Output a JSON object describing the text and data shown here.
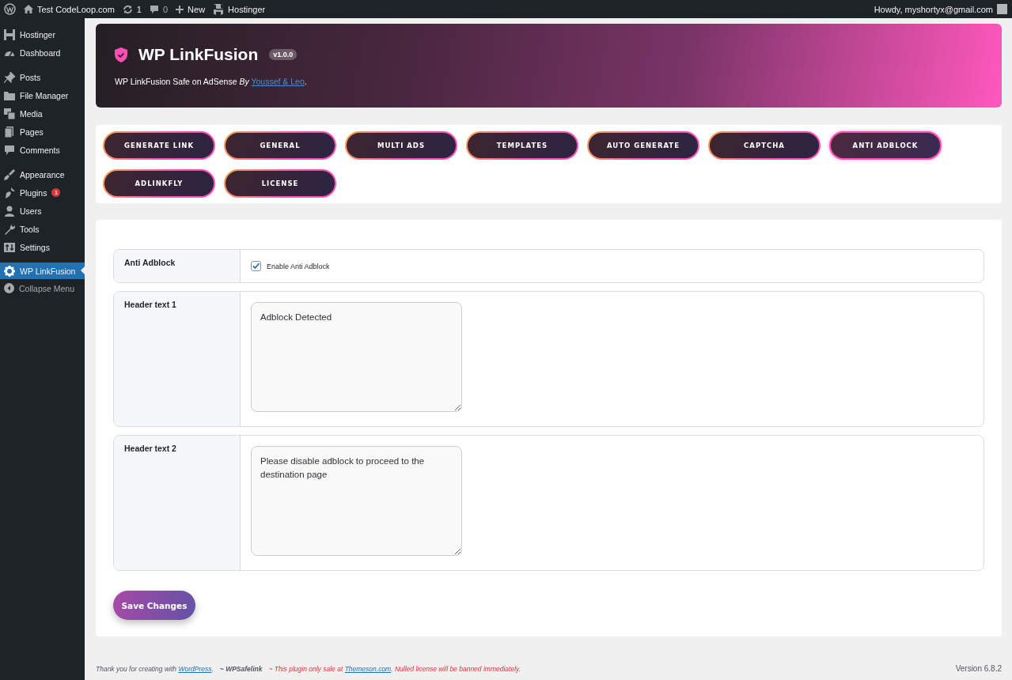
{
  "admin_bar": {
    "site": "Test CodeLoop.com",
    "updates": "1",
    "comments": "0",
    "new": "New",
    "hostinger": "Hostinger",
    "greeting": "Howdy, myshortyx@gmail.com"
  },
  "sidebar": {
    "groups": [
      [
        {
          "label": "Hostinger",
          "selected": false
        },
        {
          "label": "Dashboard",
          "selected": false
        }
      ],
      [
        {
          "label": "Posts",
          "selected": false
        },
        {
          "label": "File Manager",
          "selected": false
        },
        {
          "label": "Media",
          "selected": false
        },
        {
          "label": "Pages",
          "selected": false
        },
        {
          "label": "Comments",
          "selected": false
        }
      ],
      [
        {
          "label": "Appearance",
          "selected": false
        },
        {
          "label": "Plugins",
          "selected": false,
          "badge": "1"
        },
        {
          "label": "Users",
          "selected": false
        },
        {
          "label": "Tools",
          "selected": false
        },
        {
          "label": "Settings",
          "selected": false
        }
      ],
      [
        {
          "label": "WP LinkFusion",
          "selected": true
        }
      ]
    ],
    "collapse": "Collapse Menu"
  },
  "header": {
    "title": "WP LinkFusion",
    "version": "v1.0.0",
    "subtitle": "WP LinkFusion Safe on AdSense *By*",
    "author_link": "Youssef & Leo",
    "subtitle_end": "."
  },
  "nav_buttons": [
    {
      "label": "GENERATE LINK",
      "selected": false
    },
    {
      "label": "GENERAL",
      "selected": false
    },
    {
      "label": "MULTI ADS",
      "selected": false
    },
    {
      "label": "TEMPLATES",
      "selected": false
    },
    {
      "label": "AUTO GENERATE",
      "selected": false
    },
    {
      "label": "CAPTCHA",
      "selected": false
    },
    {
      "label": "ANTI ADBLOCK",
      "selected": true
    },
    {
      "label": "ADLINKFLY",
      "selected": false
    },
    {
      "label": "LICENSE",
      "selected": false
    }
  ],
  "fields": [
    {
      "kind": "checkbox",
      "label": "Anti Adblock",
      "option": "Enable Anti Adblock",
      "checked": true
    },
    {
      "kind": "textarea",
      "label": "Header text 1",
      "value": "Adblock Detected"
    },
    {
      "kind": "textarea",
      "label": "Header text 2",
      "value": "Please disable adblock to proceed to the destination page"
    }
  ],
  "save_button": "Save Changes",
  "footer": {
    "thanks": "Thank you for creating with",
    "wp_link": "WordPress",
    "thanks_end": ".",
    "credit": "~ WPSafelink",
    "notice": "~ This plugin only sale at",
    "notice_link": "Themeson.com",
    "notice_end": ". Nulled license will be banned immediately.",
    "version": "Version 6.8.2"
  }
}
